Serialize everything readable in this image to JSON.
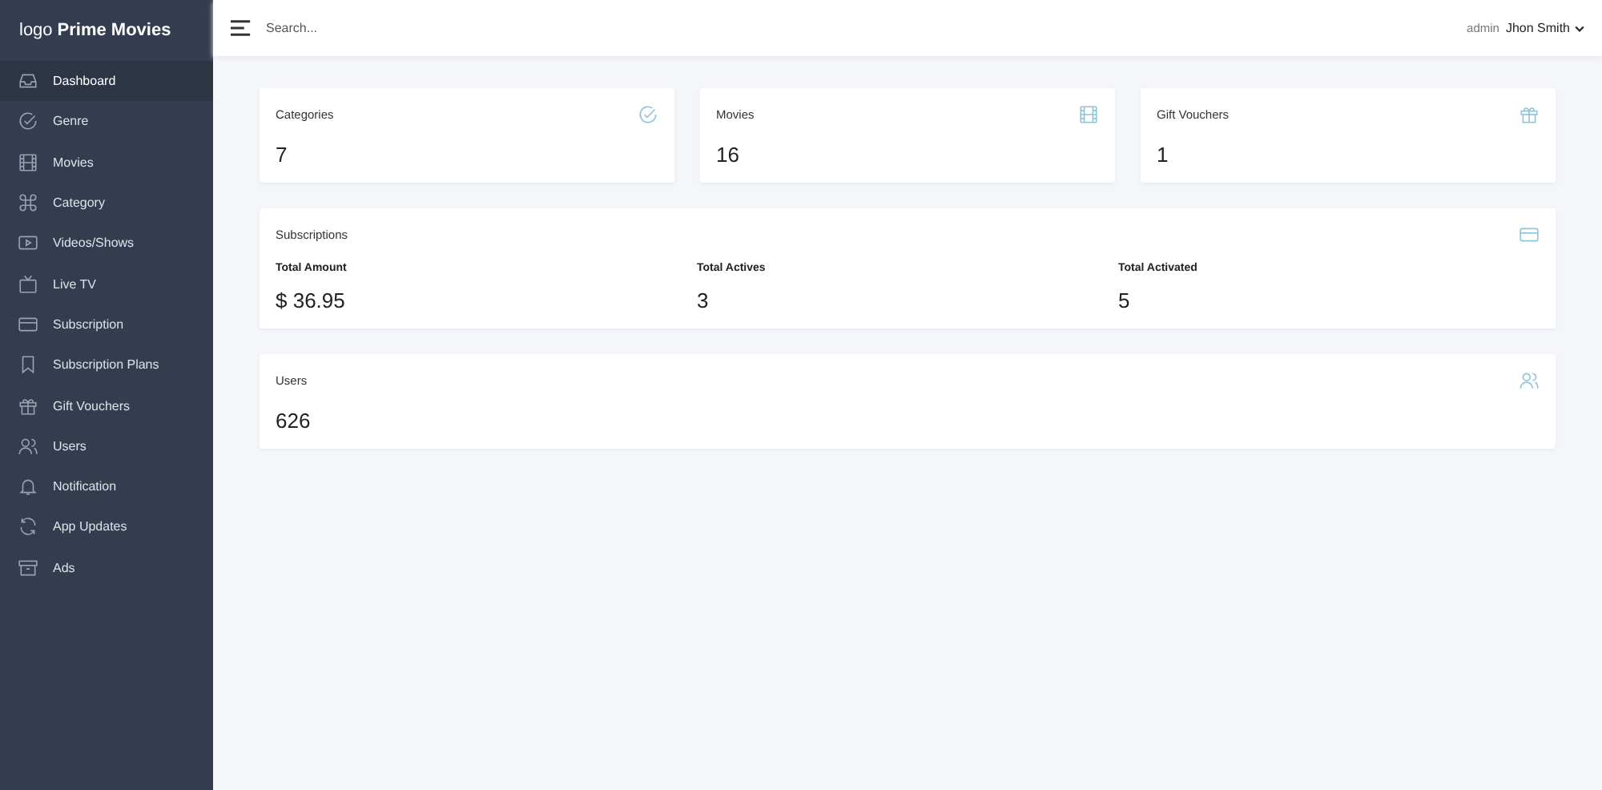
{
  "sidebar": {
    "logo": "logo",
    "brand": "Prime Movies",
    "items": [
      {
        "label": "Dashboard",
        "selected": true
      },
      {
        "label": "Genre",
        "selected": false
      },
      {
        "label": "Movies",
        "selected": false
      },
      {
        "label": "Category",
        "selected": false
      },
      {
        "label": "Videos/Shows",
        "selected": false
      },
      {
        "label": "Live TV",
        "selected": false
      },
      {
        "label": "Subscription",
        "selected": false
      },
      {
        "label": "Subscription Plans",
        "selected": false
      },
      {
        "label": "Gift Vouchers",
        "selected": false
      },
      {
        "label": "Users",
        "selected": false
      },
      {
        "label": "Notification",
        "selected": false
      },
      {
        "label": "App Updates",
        "selected": false
      },
      {
        "label": "Ads",
        "selected": false
      }
    ]
  },
  "header": {
    "search": {
      "placeholder": "Search..."
    },
    "role": "admin",
    "user": "Jhon Smith"
  },
  "stat_cards": [
    {
      "title": "Categories",
      "value": "7"
    },
    {
      "title": "Movies",
      "value": "16"
    },
    {
      "title": "Gift Vouchers",
      "value": "1"
    }
  ],
  "subscriptions": {
    "title": "Subscriptions",
    "metrics": [
      {
        "label": "Total Amount",
        "value": "$ 36.95"
      },
      {
        "label": "Total Actives",
        "value": "3"
      },
      {
        "label": "Total Activated",
        "value": "5"
      }
    ]
  },
  "users_card": {
    "title": "Users",
    "value": "626"
  }
}
